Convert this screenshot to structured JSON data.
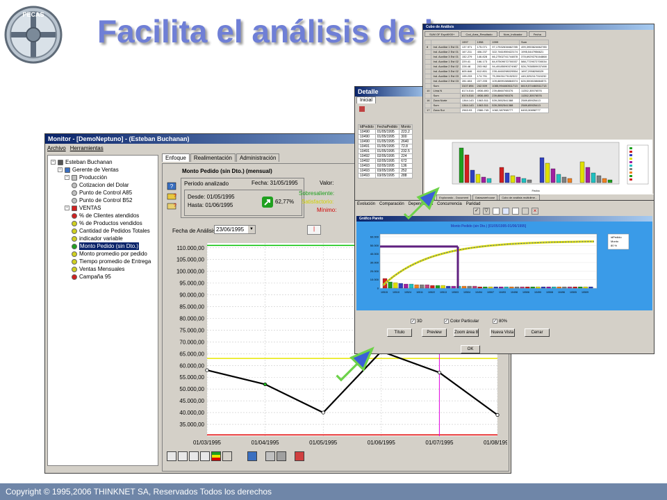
{
  "slide": {
    "title": "Facilita el análisis de la",
    "footer": "Copyright © 1995,2006 THINKNET SA, Reservados Todos los derechos",
    "logo_text": "PECAS",
    "accent": "#6f7fd6"
  },
  "monitor": {
    "title": "Monitor - [DemoNeptuno] - (Esteban Buchanan)",
    "menu": [
      "Archivo",
      "Herramientas"
    ],
    "tree": [
      {
        "label": "Esteban Buchanan",
        "depth": 0,
        "icon": "user-icon",
        "color": "#555555"
      },
      {
        "label": "Gerente de Ventas",
        "depth": 1,
        "icon": "group-icon",
        "color": "#3a6fc0"
      },
      {
        "label": "Producción",
        "depth": 2,
        "icon": "folder-icon",
        "color": "#c0c0c0"
      },
      {
        "label": "Cotizacion del Dolar",
        "depth": 3,
        "icon": "indicator-icon",
        "color": "#c0c0c0"
      },
      {
        "label": "Punto de Control A85",
        "depth": 3,
        "icon": "indicator-icon",
        "color": "#c0c0c0"
      },
      {
        "label": "Punto de Control B52",
        "depth": 3,
        "icon": "indicator-icon",
        "color": "#c0c0c0"
      },
      {
        "label": "VENTAS",
        "depth": 2,
        "icon": "folder-icon",
        "color": "#d02020"
      },
      {
        "label": "% de Clientes atendidos",
        "depth": 3,
        "icon": "indicator-icon",
        "color": "#d02020"
      },
      {
        "label": "% de Productos vendidos",
        "depth": 3,
        "icon": "indicator-icon",
        "color": "#d0d020"
      },
      {
        "label": "Cantidad de Pedidos Totales",
        "depth": 3,
        "icon": "indicator-icon",
        "color": "#d0d020"
      },
      {
        "label": "indicador variable",
        "depth": 3,
        "icon": "indicator-icon",
        "color": "#d0d020"
      },
      {
        "label": "Monto Pedido (sin Dto.)",
        "depth": 3,
        "icon": "indicator-icon",
        "color": "#20a020",
        "selected": true
      },
      {
        "label": "Monto promedio por pedido",
        "depth": 3,
        "icon": "indicator-icon",
        "color": "#d0d020"
      },
      {
        "label": "Tiempo promedio de Entrega",
        "depth": 3,
        "icon": "indicator-icon",
        "color": "#d0d020"
      },
      {
        "label": "Ventas Mensuales",
        "depth": 3,
        "icon": "indicator-icon",
        "color": "#d0d020"
      },
      {
        "label": "Campaña 95",
        "depth": 3,
        "icon": "indicator-icon",
        "color": "#d02020"
      }
    ],
    "tabs": [
      "Enfoque",
      "Realimentación",
      "Administración"
    ],
    "indicator_title": "Monto Pedido (sin Dto.) (mensual)",
    "periodo_label": "Periodo analizado",
    "fecha_label": "Fecha: 31/05/1995",
    "valor_label": "Valor:",
    "desde": "Desde: 01/05/1995",
    "hasta": "Hasta: 01/06/1995",
    "percent": "62,77%",
    "sobresaliente": "Sobresaliente:",
    "satisfactorio": "Satisfactorio:",
    "minimo": "Mínimo:",
    "fecha_analisis_label": "Fecha de Análisis",
    "fecha_analisis_value": "23/06/1995"
  },
  "chart_data": {
    "type": "line",
    "x": [
      "01/03/1995",
      "01/04/1995",
      "01/05/1995",
      "01/06/1995",
      "01/07/1995",
      "01/08/1995"
    ],
    "values": [
      58000,
      52000,
      40000,
      66000,
      57000,
      39000
    ],
    "ylim": [
      30000,
      112000
    ],
    "yticks": [
      "110.000,00",
      "105.000,00",
      "100.000,00",
      "95.000,00",
      "90.000,00",
      "85.000,00",
      "80.000,00",
      "75.000,00",
      "70.000,00",
      "65.000,00",
      "60.000,00",
      "55.000,00",
      "50.000,00",
      "45.000,00",
      "40.000,00",
      "35.000,00"
    ],
    "ytick_values": [
      110000,
      105000,
      100000,
      95000,
      90000,
      85000,
      80000,
      75000,
      70000,
      65000,
      60000,
      55000,
      50000,
      45000,
      40000,
      35000
    ],
    "thresholds": {
      "green": 111000,
      "yellow": 63000,
      "red": 30500
    },
    "marker_x": "01/07/1995",
    "colors": {
      "line": "#000000",
      "green": "#00c000",
      "yellow": "#e8e800",
      "red": "#e00000",
      "marker": "#e000e0"
    }
  },
  "detalle": {
    "title": "Detalle",
    "tab": "Inicial",
    "columns": [
      "IdPedido",
      "FechaPedido",
      "Monto"
    ],
    "rows": [
      [
        "10490",
        "01/05/1995",
        "223.2"
      ],
      [
        "10490",
        "01/05/1995",
        "300"
      ],
      [
        "10490",
        "01/05/1995",
        "2640"
      ],
      [
        "10491",
        "01/05/1995",
        "72.8"
      ],
      [
        "10491",
        "01/05/1995",
        "232.5"
      ],
      [
        "10492",
        "02/05/1995",
        "224"
      ],
      [
        "10492",
        "02/05/1995",
        "672"
      ],
      [
        "10493",
        "02/05/1995",
        "136"
      ],
      [
        "10493",
        "03/05/1995",
        "252"
      ],
      [
        "10493",
        "03/05/1995",
        "288"
      ]
    ]
  },
  "cubo": {
    "title": "Cubo de Análisis",
    "headers": [
      "SUM OF ExpdtX00+",
      "Cod_Area_Resultado",
      "Nom_Indicador",
      "Fecha"
    ],
    "col_years": [
      "1997",
      "1998",
      "1999",
      "Sum"
    ],
    "rows": [
      [
        "Ind. Auxiliar 1 Est 01",
        "137.971",
        "175.071",
        "97,17532634662785",
        "499,3953624662785"
      ],
      [
        "Ind. Auxiliar 2 Est 01",
        "167.211",
        "406.237",
        "322,7461959422174",
        "1995,5447956621"
      ],
      [
        "Ind. Auxiliar 3 Est 01",
        "152.279",
        "146.828",
        "66,27502741744878",
        "378,6929276164868"
      ],
      [
        "Ind. Auxiliar 1 Est 02",
        "229.41",
        "166.173",
        "84,97509072700037",
        "588,7729072700034"
      ],
      [
        "Ind. Auxiliar 2 Est 02",
        "228.48",
        "203.962",
        "94,49185090374987",
        "526,7938509037498"
      ],
      [
        "Ind. Auxiliar 3 Est 02",
        "605.846",
        "612.801",
        "239,4460298029554",
        "1697,2958298029"
      ],
      [
        "Ind. Auxiliar 1 Est 03",
        "195.233",
        "174.791",
        "75,39431173152322",
        "445,3252117315232"
      ],
      [
        "Ind. Auxiliar 2 Est 03",
        "281.604",
        "227.205",
        "109,8899158884574",
        "626,5008158884571"
      ],
      [
        "Sum",
        "3107.894",
        "242.509",
        "1085,994460511713",
        "6619,574460511713"
      ],
      [
        "Lima N",
        "8174.516",
        "4936.893",
        "239,8860765376",
        "11352,30576576"
      ],
      [
        "Sum",
        "8174.516",
        "4936.893",
        "239,8860765376",
        "11352,30576576"
      ],
      [
        "Zona Norte",
        "1364.143",
        "1063.511",
        "539,2852541388",
        "2589,85925413"
      ],
      [
        "Sum",
        "1364.143",
        "1063.511",
        "539,2852541388",
        "2589,85925413"
      ],
      [
        "Zona Sur",
        "2963.93",
        "2386.745",
        "1082,387998777",
        "6453,30898777"
      ]
    ],
    "group_ids": [
      "8",
      "10",
      "16",
      "17"
    ],
    "taskbar": [
      "Start",
      "Explorando - Document",
      "Datawarehouse",
      "Cubo de análisis multidime..."
    ],
    "axis_label": "Fecha"
  },
  "pareto": {
    "menu": [
      "Evolución",
      "Comparación",
      "Dependencia",
      "Concurrencia",
      "Paridad"
    ],
    "title": "Gráfico Pareto",
    "chart_title": "Monto Pedido (sin Dto.) [01/05/1995-01/06/1995]",
    "legend": [
      "idPedido",
      "Monto",
      "80 %"
    ],
    "yticks": [
      "60.000",
      "50.000",
      "40.000",
      "30.000",
      "20.000",
      "10.000",
      "0"
    ],
    "xticks": [
      "10515",
      "10510",
      "10524",
      "10511",
      "10522",
      "10513",
      "10503",
      "10504",
      "10494",
      "10507",
      "10493",
      "10498",
      "10506",
      "10490",
      "10508",
      "10496",
      "10505",
      "10509"
    ],
    "checkboxes": [
      "3D",
      "Color Particular",
      "80%"
    ],
    "buttons": [
      "Título",
      "Preview",
      "Zoom área 80%",
      "Nueva Vista",
      "Cerrar"
    ],
    "ok": "OK"
  }
}
